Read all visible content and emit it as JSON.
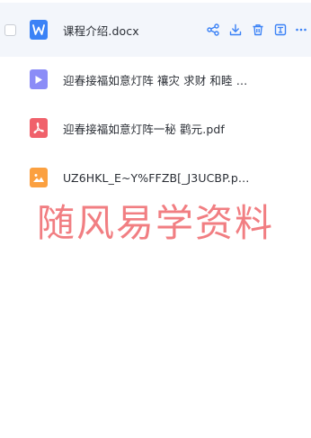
{
  "files": [
    {
      "name": "课程介绍.docx",
      "type": "word",
      "color": "#3b82f6"
    },
    {
      "name": "迎春接福如意灯阵 禳灾 求财 和睦 恩...",
      "type": "video",
      "color": "#8b8cf7"
    },
    {
      "name": "迎春接福如意灯阵一秘 鹳元.pdf",
      "type": "pdf",
      "color": "#f0616b"
    },
    {
      "name": "UZ6HKL_E~Y%FFZB[_J3UCBP.png",
      "type": "image",
      "color": "#fba040"
    }
  ],
  "row_actions": [
    "share-icon",
    "download-icon",
    "delete-icon",
    "rename-icon",
    "more-icon"
  ],
  "action_color": "#3b82f6",
  "watermark": "随风易学资料"
}
